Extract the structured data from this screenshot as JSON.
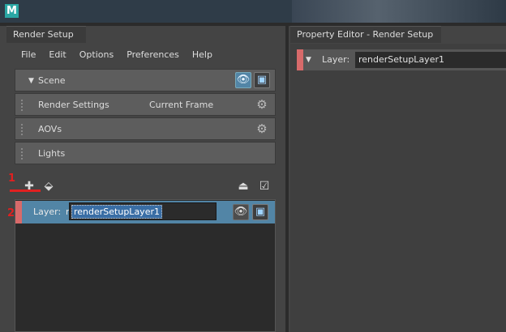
{
  "app": {
    "logo": "M"
  },
  "left_panel": {
    "tab_title": "Render Setup",
    "menu": [
      "File",
      "Edit",
      "Options",
      "Preferences",
      "Help"
    ],
    "scene": {
      "label": "Scene"
    },
    "collections": [
      {
        "label": "Render Settings",
        "value": "Current Frame"
      },
      {
        "label": "AOVs"
      },
      {
        "label": "Lights"
      }
    ],
    "annotations": [
      "1",
      "2"
    ],
    "layer": {
      "label": "Layer:",
      "prefix": "r",
      "name": "renderSetupLayer1"
    }
  },
  "right_panel": {
    "tab_title": "Property Editor - Render Setup",
    "row": {
      "label": "Layer:",
      "value": "renderSetupLayer1"
    }
  },
  "icons": {
    "eye": "eye-icon",
    "render": "render-icon",
    "gear": "gear-icon",
    "create": "create-layer-icon",
    "import": "import-layer-icon"
  },
  "colors": {
    "selected_row": "#5285a6",
    "layer_marker": "#d86a6a",
    "annotation": "#e02020"
  }
}
